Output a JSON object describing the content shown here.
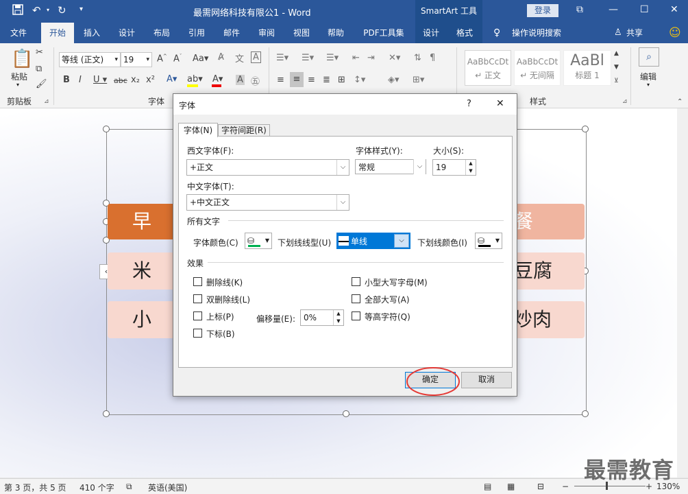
{
  "titlebar": {
    "doc_title": "最需网络科技有限公1 - Word",
    "smartart_context": "SmartArt 工具",
    "login": "登录",
    "icons": [
      "save-icon",
      "undo-icon",
      "redo-icon",
      "customize-icon"
    ]
  },
  "tabs": [
    "文件",
    "开始",
    "插入",
    "设计",
    "布局",
    "引用",
    "邮件",
    "审阅",
    "视图",
    "帮助",
    "PDF工具集",
    "设计",
    "格式"
  ],
  "tell_me": "操作说明搜索",
  "share": "共享",
  "ribbon": {
    "paste": "粘贴",
    "clipboard_group": "剪贴板",
    "font_name": "等线 (正文)",
    "font_size": "19",
    "font_group": "字体",
    "styles": [
      {
        "sample": "AaBbCcDt",
        "name": "↵ 正文"
      },
      {
        "sample": "AaBbCcDt",
        "name": "↵ 无间隔"
      },
      {
        "sample": "AaBl",
        "name": "标题 1"
      }
    ],
    "styles_group": "样式",
    "edit": "编辑"
  },
  "smartart": {
    "rows": [
      {
        "left": "早",
        "right": "餐",
        "color": "#d9702f"
      },
      {
        "left": "米",
        "right": "豆腐",
        "color": "#f8d8cf"
      },
      {
        "left": "小",
        "right": "炒肉",
        "color": "#f8d8cf"
      }
    ]
  },
  "dialog": {
    "title": "字体",
    "help": "?",
    "close": "✕",
    "tabs": [
      "字体(N)",
      "字符间距(R)"
    ],
    "western_font_label": "西文字体(F):",
    "western_font_value": "+正文",
    "style_label": "字体样式(Y):",
    "style_value": "常规",
    "size_label": "大小(S):",
    "size_value": "19",
    "asian_font_label": "中文字体(T):",
    "asian_font_value": "+中文正文",
    "all_text_label": "所有文字",
    "font_color_label": "字体颜色(C)",
    "underline_style_label": "下划线线型(U)",
    "underline_style_value": "单线",
    "underline_color_label": "下划线颜色(I)",
    "effects_label": "效果",
    "effects_left": [
      "删除线(K)",
      "双删除线(L)",
      "上标(P)",
      "下标(B)"
    ],
    "effects_right": [
      "小型大写字母(M)",
      "全部大写(A)",
      "等高字符(Q)"
    ],
    "offset_label": "偏移量(E):",
    "offset_value": "0%",
    "ok": "确定",
    "cancel": "取消",
    "font_color_swatch": "#00b050"
  },
  "statusbar": {
    "page": "第 3 页，共 5 页",
    "words": "410 个字",
    "language": "英语(美国)",
    "zoom": "130%"
  },
  "watermark": "最需教育"
}
